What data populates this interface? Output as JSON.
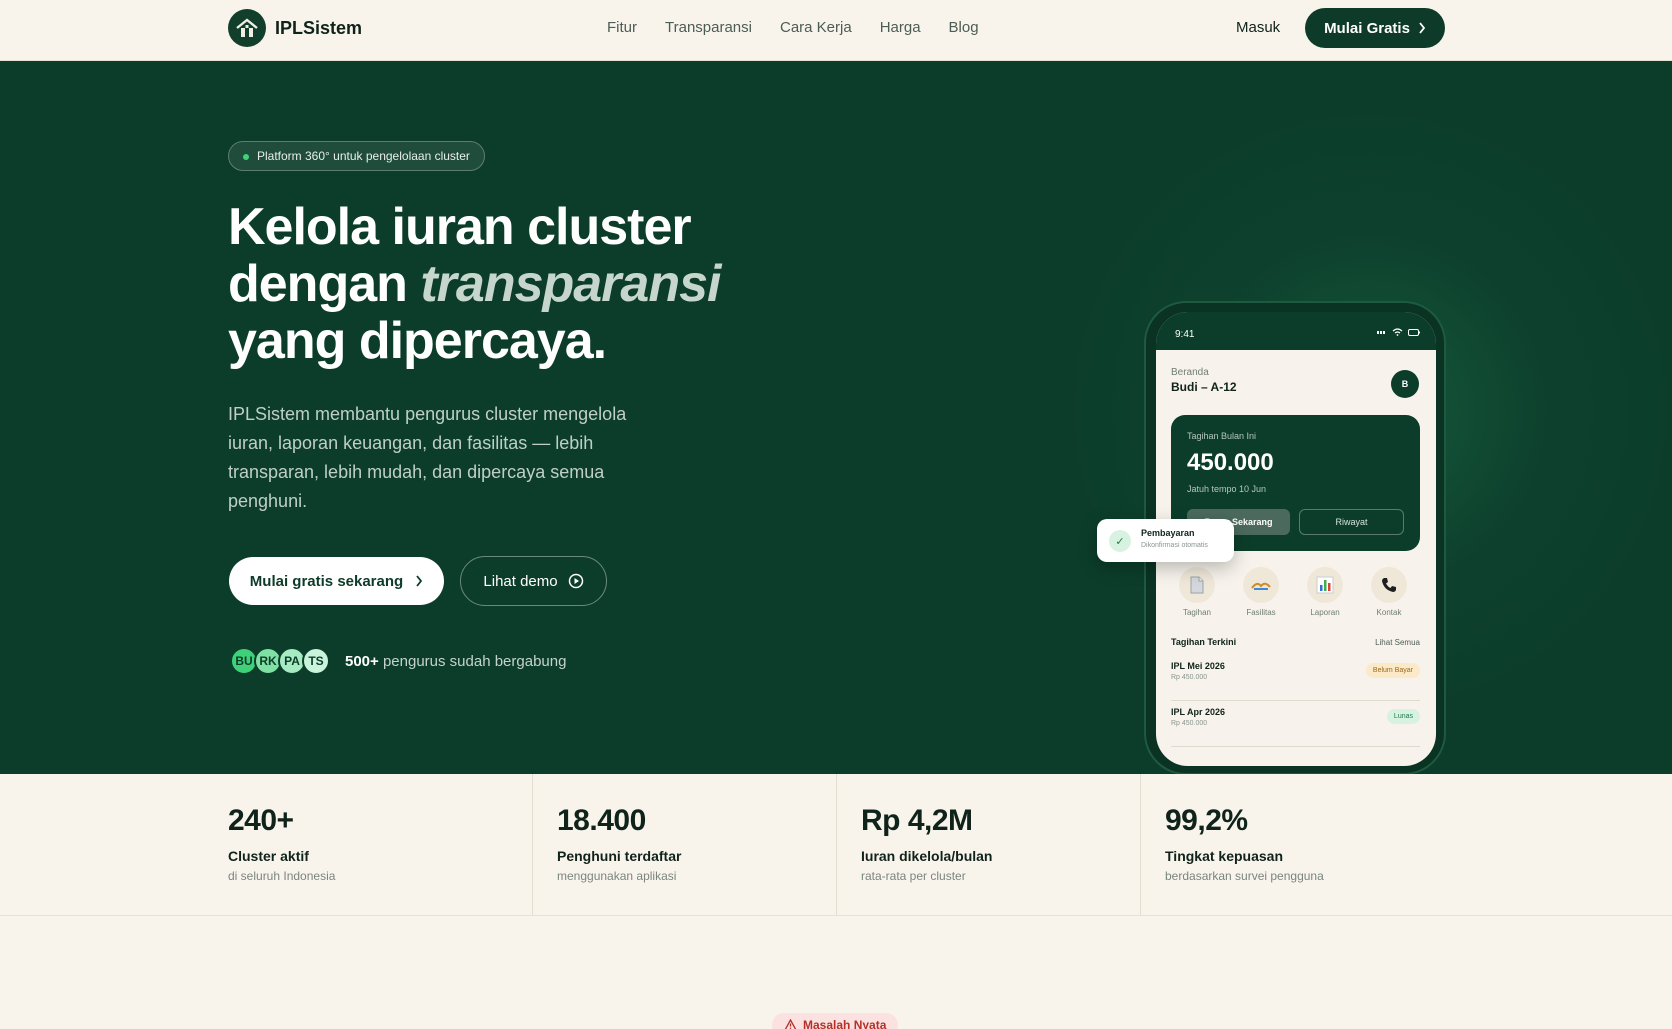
{
  "nav": {
    "brand": "IPLSistem",
    "links": [
      "Fitur",
      "Transparansi",
      "Cara Kerja",
      "Harga",
      "Blog"
    ],
    "login": "Masuk",
    "cta": "Mulai Gratis"
  },
  "hero": {
    "badge": "Platform 360° untuk pengelolaan cluster",
    "title_line1": "Kelola iuran cluster",
    "title_line2_a": "dengan ",
    "title_line2_em": "transparansi",
    "title_line3": "yang dipercaya.",
    "lead": "IPLSistem membantu pengurus cluster mengelola iuran, laporan keuangan, dan fasilitas — lebih transparan, lebih mudah, dan dipercaya semua penghuni.",
    "primary_cta": "Mulai gratis sekarang",
    "secondary_cta": "Lihat demo",
    "avatars": [
      "BU",
      "RK",
      "PA",
      "TS"
    ],
    "joined_count": "500+",
    "joined_text": " pengurus sudah bergabung"
  },
  "phone": {
    "time": "9:41",
    "greeting": "Beranda",
    "user": "Budi – A-12",
    "avatar_initial": "B",
    "bill_label": "Tagihan Bulan Ini",
    "bill_amount": "450.000",
    "bill_due": "Jatuh tempo 10 Jun",
    "pay_button": "Bayar Sekarang",
    "history_button": "Riwayat",
    "quick_actions": [
      "Tagihan",
      "Fasilitas",
      "Laporan",
      "Kontak"
    ],
    "recent_title": "Tagihan Terkini",
    "recent_all": "Lihat Semua",
    "recent": [
      {
        "title": "IPL Mei 2026",
        "amount": "Rp 450.000",
        "status": "Belum Bayar"
      },
      {
        "title": "IPL Apr 2026",
        "amount": "Rp 450.000",
        "status": "Lunas"
      }
    ]
  },
  "toast": {
    "title": "Pembayaran",
    "subtitle": "Dikonfirmasi otomatis"
  },
  "stats": [
    {
      "value": "240+",
      "label": "Cluster aktif",
      "sub": "di seluruh Indonesia"
    },
    {
      "value": "18.400",
      "label": "Penghuni terdaftar",
      "sub": "menggunakan aplikasi"
    },
    {
      "value": "Rp 4,2M",
      "label": "Iuran dikelola/bulan",
      "sub": "rata-rata per cluster"
    },
    {
      "value": "99,2%",
      "label": "Tingkat kepuasan",
      "sub": "berdasarkan survei pengguna"
    }
  ],
  "section_badge": "Masalah Nyata",
  "colors": {
    "brand_dark": "#0c3d2b",
    "page_bg": "#f8f4ec",
    "accent_green": "#3fd17a",
    "avatar_colors": [
      "#3fd17a",
      "#7fe0a4",
      "#a7ebc3",
      "#c9f3da"
    ]
  }
}
